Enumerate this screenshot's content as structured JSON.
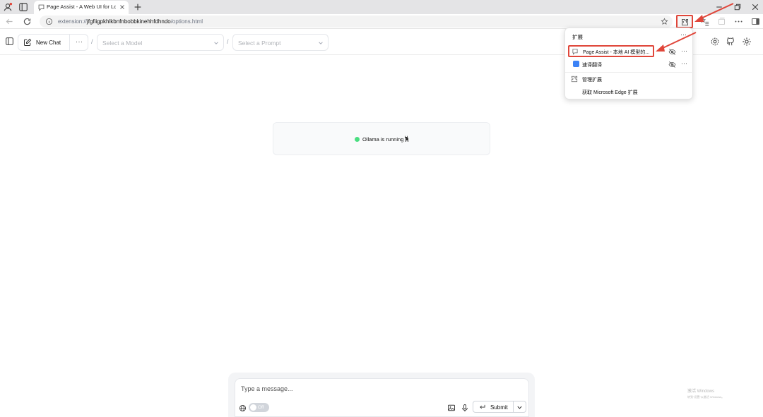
{
  "browser": {
    "tab_title": "Page Assist - A Web UI for Local AI",
    "address": {
      "prefix": "extension://",
      "host": "jfgfiigpkhlkbnfnbobbkinehhfdhndo",
      "path": "/options.html"
    }
  },
  "header": {
    "new_chat_label": "New Chat",
    "more_label": "···",
    "separator": "/",
    "model_placeholder": "Select a Model",
    "prompt_placeholder": "Select a Prompt"
  },
  "status": {
    "text": "Ollama is running",
    "dot_color": "#4ade80"
  },
  "extensions_menu": {
    "title": "扩展",
    "more": "···",
    "items": [
      {
        "label": "Page Assist - 本地 AI 模型的..."
      },
      {
        "label": "速译翻译"
      },
      {
        "label": "管理扩展"
      },
      {
        "label": "获取 Microsoft Edge 扩展"
      }
    ]
  },
  "composer": {
    "placeholder": "Type a message...",
    "toggle_label": "Off",
    "submit_label": "Submit"
  },
  "watermark": {
    "line1": "激活 Windows",
    "line2": "转到\"设置\"以激活 Windows。"
  },
  "colors": {
    "annotation_red": "#e0463a",
    "accent_green": "#4ade80"
  }
}
